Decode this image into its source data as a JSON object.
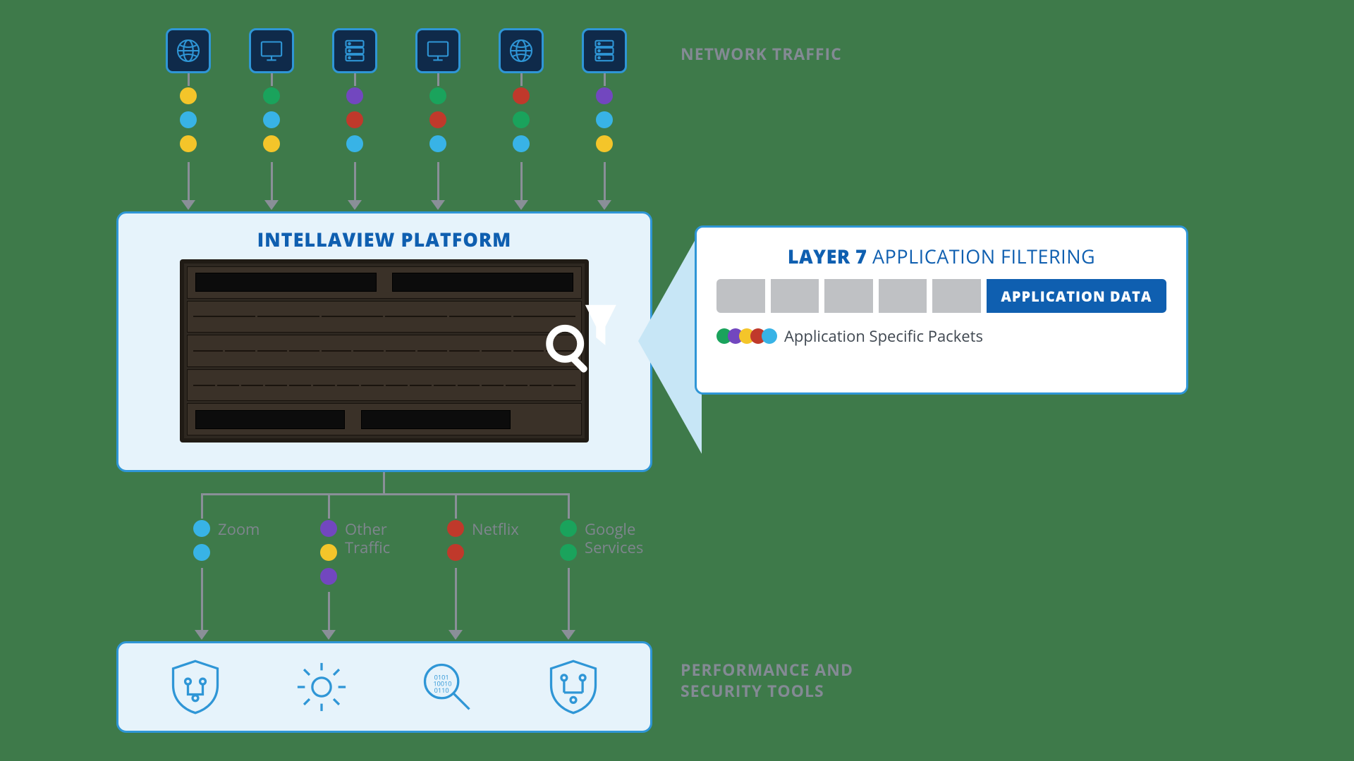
{
  "labels": {
    "network_traffic": "NETWORK TRAFFIC",
    "platform_title": "INTELLAVIEW PLATFORM",
    "filter_title_bold": "LAYER 7",
    "filter_title_rest": " APPLICATION FILTERING",
    "app_data": "APPLICATION DATA",
    "legend": "Application Specific Packets",
    "tools_title_l1": "PERFORMANCE AND",
    "tools_title_l2": "SECURITY TOOLS"
  },
  "sources": [
    {
      "icon": "globe",
      "packets": [
        "yellow",
        "blue",
        "yellow"
      ]
    },
    {
      "icon": "monitor",
      "packets": [
        "green",
        "blue",
        "yellow"
      ]
    },
    {
      "icon": "server",
      "packets": [
        "purple",
        "red",
        "blue"
      ]
    },
    {
      "icon": "monitor",
      "packets": [
        "green",
        "red",
        "blue"
      ]
    },
    {
      "icon": "globe",
      "packets": [
        "red",
        "green",
        "blue"
      ]
    },
    {
      "icon": "server",
      "packets": [
        "purple",
        "blue",
        "yellow"
      ]
    }
  ],
  "outputs": [
    {
      "label": "Zoom",
      "packets": [
        "blue",
        "blue"
      ]
    },
    {
      "label": "Other\nTraffic",
      "packets": [
        "purple",
        "yellow",
        "purple"
      ]
    },
    {
      "label": "Netflix",
      "packets": [
        "red",
        "red"
      ]
    },
    {
      "label": "Google\nServices",
      "packets": [
        "green",
        "green"
      ]
    }
  ],
  "legend_dots": [
    "green",
    "purple",
    "yellow",
    "red",
    "blue"
  ],
  "colors": {
    "blue": "#38b3e6",
    "yellow": "#f4c52a",
    "green": "#1aa35c",
    "purple": "#7247bf",
    "red": "#c0392b",
    "accent": "#2f96d6",
    "brand": "#0f5fb0",
    "panel_bg": "#e6f3fb",
    "page_bg": "#3e7a4a",
    "muted_text": "#848a94"
  }
}
